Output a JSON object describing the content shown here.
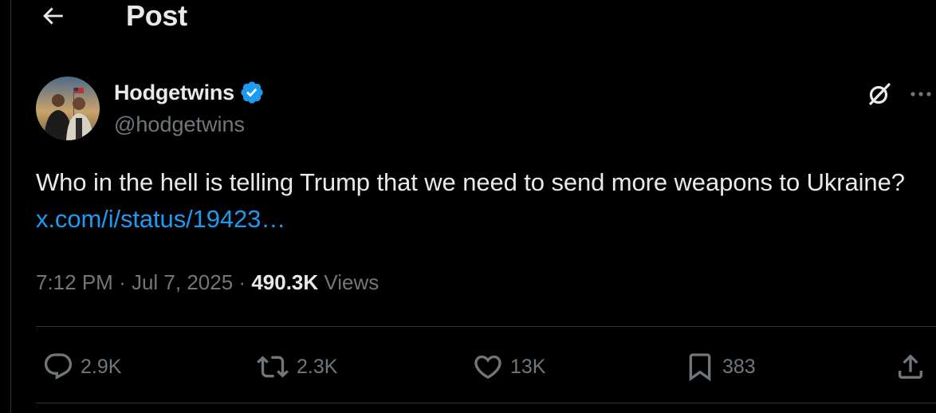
{
  "header": {
    "title": "Post",
    "back_icon": "arrow-left-icon"
  },
  "tweet": {
    "author": {
      "name": "Hodgetwins",
      "handle": "@hodgetwins",
      "verified_color": "#1d9bf0"
    },
    "text": "Who in the hell is telling Trump that we need to send more weapons to Ukraine?",
    "link": "x.com/i/status/19423…",
    "time": "7:12 PM",
    "date": "Jul 7, 2025",
    "views_count": "490.3K",
    "views_label": "Views",
    "separator": "·"
  },
  "actions": {
    "replies": "2.9K",
    "reposts": "2.3K",
    "likes": "13K",
    "bookmarks": "383"
  },
  "colors": {
    "background": "#000000",
    "text": "#e7e9ea",
    "secondary": "#71767b",
    "accent": "#1d9bf0",
    "border": "#2f3336"
  }
}
